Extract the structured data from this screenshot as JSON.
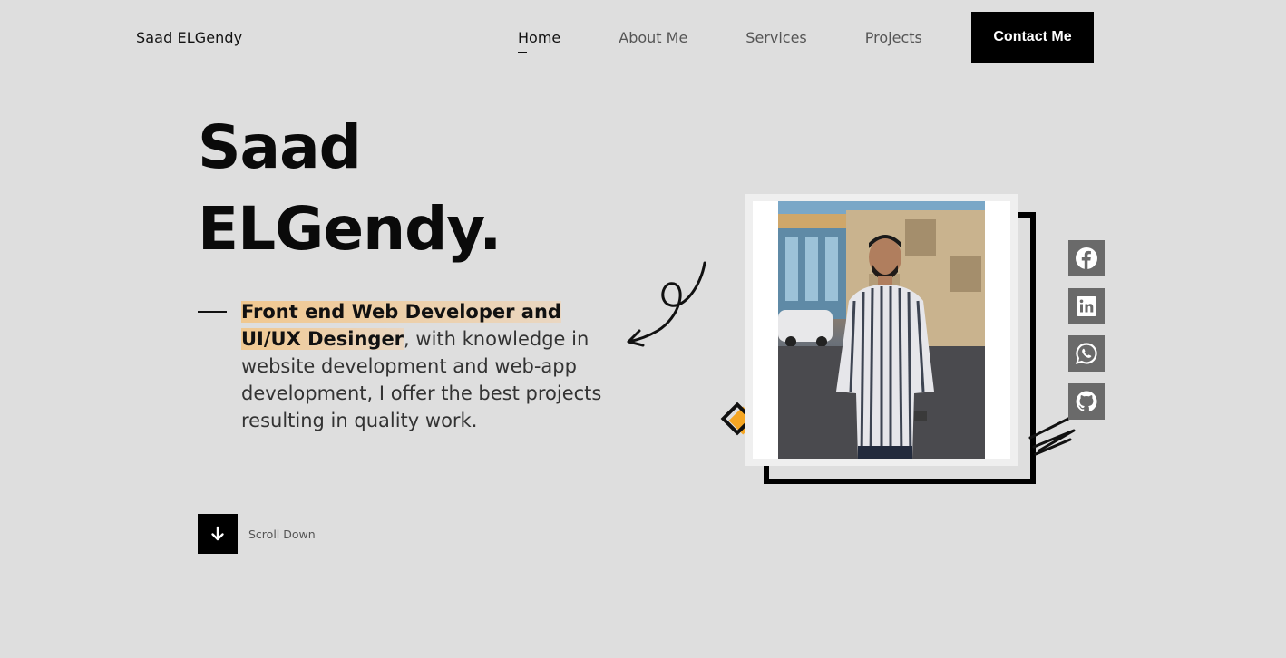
{
  "brand": "Saad ELGendy",
  "nav": {
    "home": "Home",
    "about": "About Me",
    "services": "Services",
    "projects": "Projects",
    "contact": "Contact Me"
  },
  "hero": {
    "title_line1": "Saad",
    "title_line2": "ELGendy.",
    "desc_highlight_1": "Front end Web Developer and",
    "desc_highlight_2": "UI/UX Desinger",
    "desc_rest": ", with knowledge in website development and web-app development, I offer the best projects resulting in quality work."
  },
  "scroll": {
    "label": "Scroll Down",
    "icon": "arrow-down-icon"
  },
  "social": [
    {
      "name": "facebook",
      "icon": "facebook-icon"
    },
    {
      "name": "linkedin",
      "icon": "linkedin-icon"
    },
    {
      "name": "whatsapp",
      "icon": "whatsapp-icon"
    },
    {
      "name": "github",
      "icon": "github-icon"
    }
  ],
  "colors": {
    "background": "#dedede",
    "accent": "#f5a623",
    "highlight_start": "#f0c890",
    "social_bg": "#6a6a6a",
    "button_bg": "#000000"
  }
}
